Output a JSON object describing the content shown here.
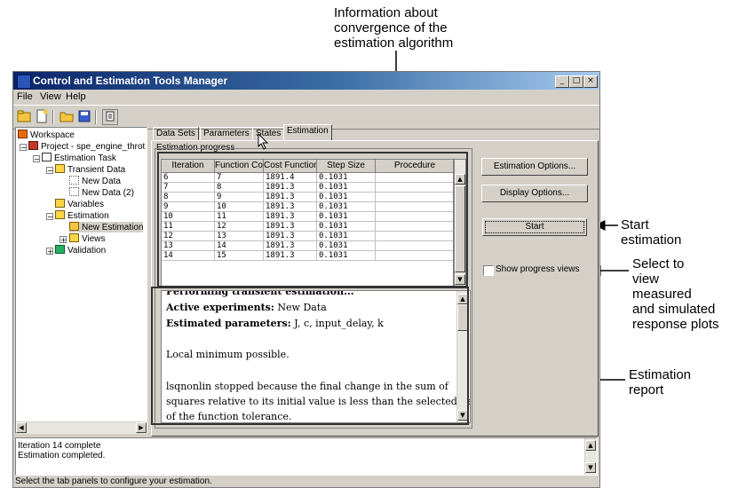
{
  "callouts": {
    "convergence": [
      "Information about",
      "convergence of the",
      "estimation algorithm"
    ],
    "start": [
      "Start",
      "estimation"
    ],
    "select": [
      "Select to",
      "view",
      "measured",
      "and simulated",
      "response plots"
    ],
    "report": [
      "Estimation",
      "report"
    ]
  },
  "window": {
    "title": "Control and Estimation Tools Manager",
    "controls": [
      "_",
      "□",
      "×"
    ]
  },
  "menu": [
    "File",
    "View",
    "Help"
  ],
  "toolbar_icons": [
    "new-folder-icon",
    "new-document-icon",
    "open-folder-icon",
    "save-icon",
    "properties-icon"
  ],
  "tree": {
    "workspace": "Workspace",
    "project": "Project - spe_engine_throt",
    "estimation_task": "Estimation Task",
    "transient_data": "Transient Data",
    "new_data": "New Data",
    "new_data_2": "New Data (2)",
    "variables": "Variables",
    "estimation": "Estimation",
    "new_estimation": "New Estimation",
    "views": "Views",
    "validation": "Validation"
  },
  "tabs": [
    "Data Sets",
    "Parameters",
    "States",
    "Estimation"
  ],
  "group_title": "Estimation progress",
  "table": {
    "headers": [
      "Iteration",
      "Function Co...",
      "Cost Function",
      "Step Size",
      "Procedure"
    ],
    "rows": [
      [
        "6",
        "7",
        "1891.4",
        "0.1031",
        ""
      ],
      [
        "7",
        "8",
        "1891.3",
        "0.1031",
        ""
      ],
      [
        "8",
        "9",
        "1891.3",
        "0.1031",
        ""
      ],
      [
        "9",
        "10",
        "1891.3",
        "0.1031",
        ""
      ],
      [
        "10",
        "11",
        "1891.3",
        "0.1031",
        ""
      ],
      [
        "11",
        "12",
        "1891.3",
        "0.1031",
        ""
      ],
      [
        "12",
        "13",
        "1891.3",
        "0.1031",
        ""
      ],
      [
        "13",
        "14",
        "1891.3",
        "0.1031",
        ""
      ],
      [
        "14",
        "15",
        "1891.3",
        "0.1031",
        ""
      ]
    ]
  },
  "buttons": {
    "estimation_options": "Estimation Options...",
    "display_options": "Display Options...",
    "start": "Start"
  },
  "checkbox": {
    "label": "Show progress views",
    "checked": false
  },
  "report": {
    "heading": "Performing transient estimation...",
    "active_label": "Active experiments:",
    "active_value": " New Data",
    "params_label": "Estimated parameters:",
    "params_value": " J, c, input_delay, k",
    "local_min": "Local minimum possible.",
    "lines": [
      "lsqnonlin stopped because the final change in the sum of",
      "squares relative to its initial value is less than the selected value",
      "of the function tolerance."
    ]
  },
  "log": [
    "Iteration 14 complete",
    "Estimation completed."
  ],
  "status": "Select the tab panels to configure your estimation."
}
